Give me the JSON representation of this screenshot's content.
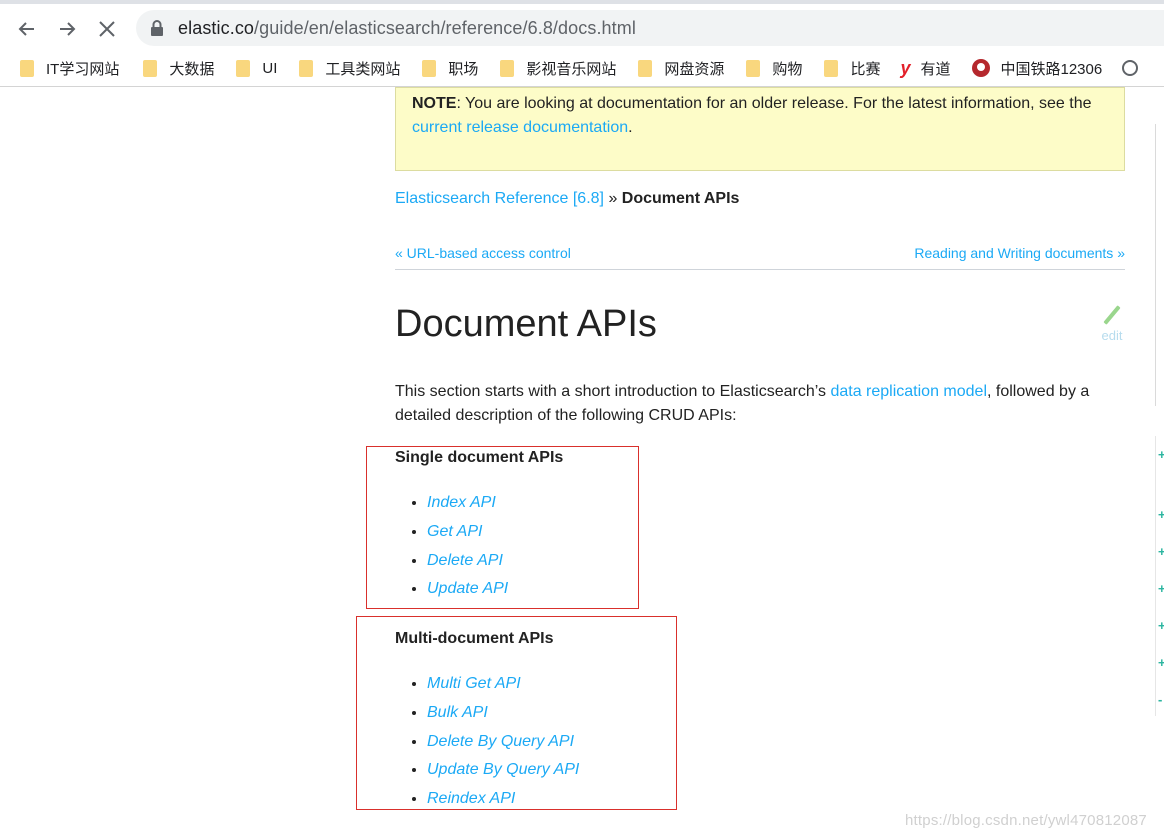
{
  "browser": {
    "url_host": "elastic.co",
    "url_path": "/guide/en/elasticsearch/reference/6.8/docs.html",
    "bookmarks": [
      {
        "label": "IT学习网站",
        "icon": "folder-icon"
      },
      {
        "label": "大数据",
        "icon": "folder-icon"
      },
      {
        "label": "UI",
        "icon": "folder-icon"
      },
      {
        "label": "工具类网站",
        "icon": "folder-icon"
      },
      {
        "label": "职场",
        "icon": "folder-icon"
      },
      {
        "label": "影视音乐网站",
        "icon": "folder-icon"
      },
      {
        "label": "网盘资源",
        "icon": "folder-icon"
      },
      {
        "label": "购物",
        "icon": "folder-icon"
      },
      {
        "label": "比赛",
        "icon": "folder-icon"
      },
      {
        "label": "有道",
        "icon": "youdao-icon"
      },
      {
        "label": "中国铁路12306",
        "icon": "railway-icon"
      }
    ]
  },
  "note": {
    "label": "NOTE",
    "text": ": You are looking at documentation for an older release. For the latest information, see the ",
    "link": "current release documentation",
    "end": "."
  },
  "breadcrumb": {
    "parent": "Elasticsearch Reference [6.8]",
    "sep": " » ",
    "current": "Document APIs"
  },
  "pager": {
    "prev": "« URL-based access control",
    "next": "Reading and Writing documents »"
  },
  "page": {
    "title": "Document APIs",
    "edit_label": "edit",
    "intro_before": "This section starts with a short introduction to Elasticsearch’s ",
    "intro_link": "data replication model",
    "intro_after": ", followed by a detailed description of the following CRUD APIs:"
  },
  "sections": {
    "single_title": "Single document APIs",
    "single_items": [
      "Index API",
      "Get API",
      "Delete API",
      "Update API"
    ],
    "multi_title": "Multi-document APIs",
    "multi_items": [
      "Multi Get API",
      "Bulk API",
      "Delete By Query API",
      "Update By Query API",
      "Reindex API"
    ]
  },
  "watermark": "https://blog.csdn.net/ywl470812087",
  "colors": {
    "link": "#1ba9f5",
    "note_bg": "#fdfcc8",
    "highlight_box": "#d9302c"
  }
}
